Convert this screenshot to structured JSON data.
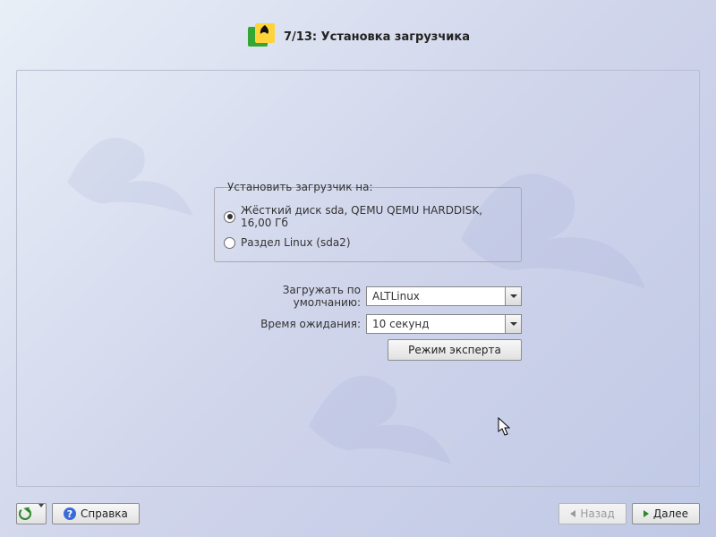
{
  "header": {
    "title": "7/13: Установка загрузчика"
  },
  "fieldset": {
    "legend": "Установить загрузчик на:",
    "options": [
      {
        "label": "Жёсткий диск sda, QEMU QEMU HARDDISK, 16,00 Гб",
        "checked": true
      },
      {
        "label": "Раздел Linux (sda2)",
        "checked": false
      }
    ]
  },
  "form": {
    "default_boot_label": "Загружать по умолчанию:",
    "default_boot_value": "ALTLinux",
    "timeout_label": "Время ожидания:",
    "timeout_value": "10 секунд"
  },
  "buttons": {
    "expert": "Режим эксперта",
    "help": "Справка",
    "back": "Назад",
    "next": "Далее"
  }
}
